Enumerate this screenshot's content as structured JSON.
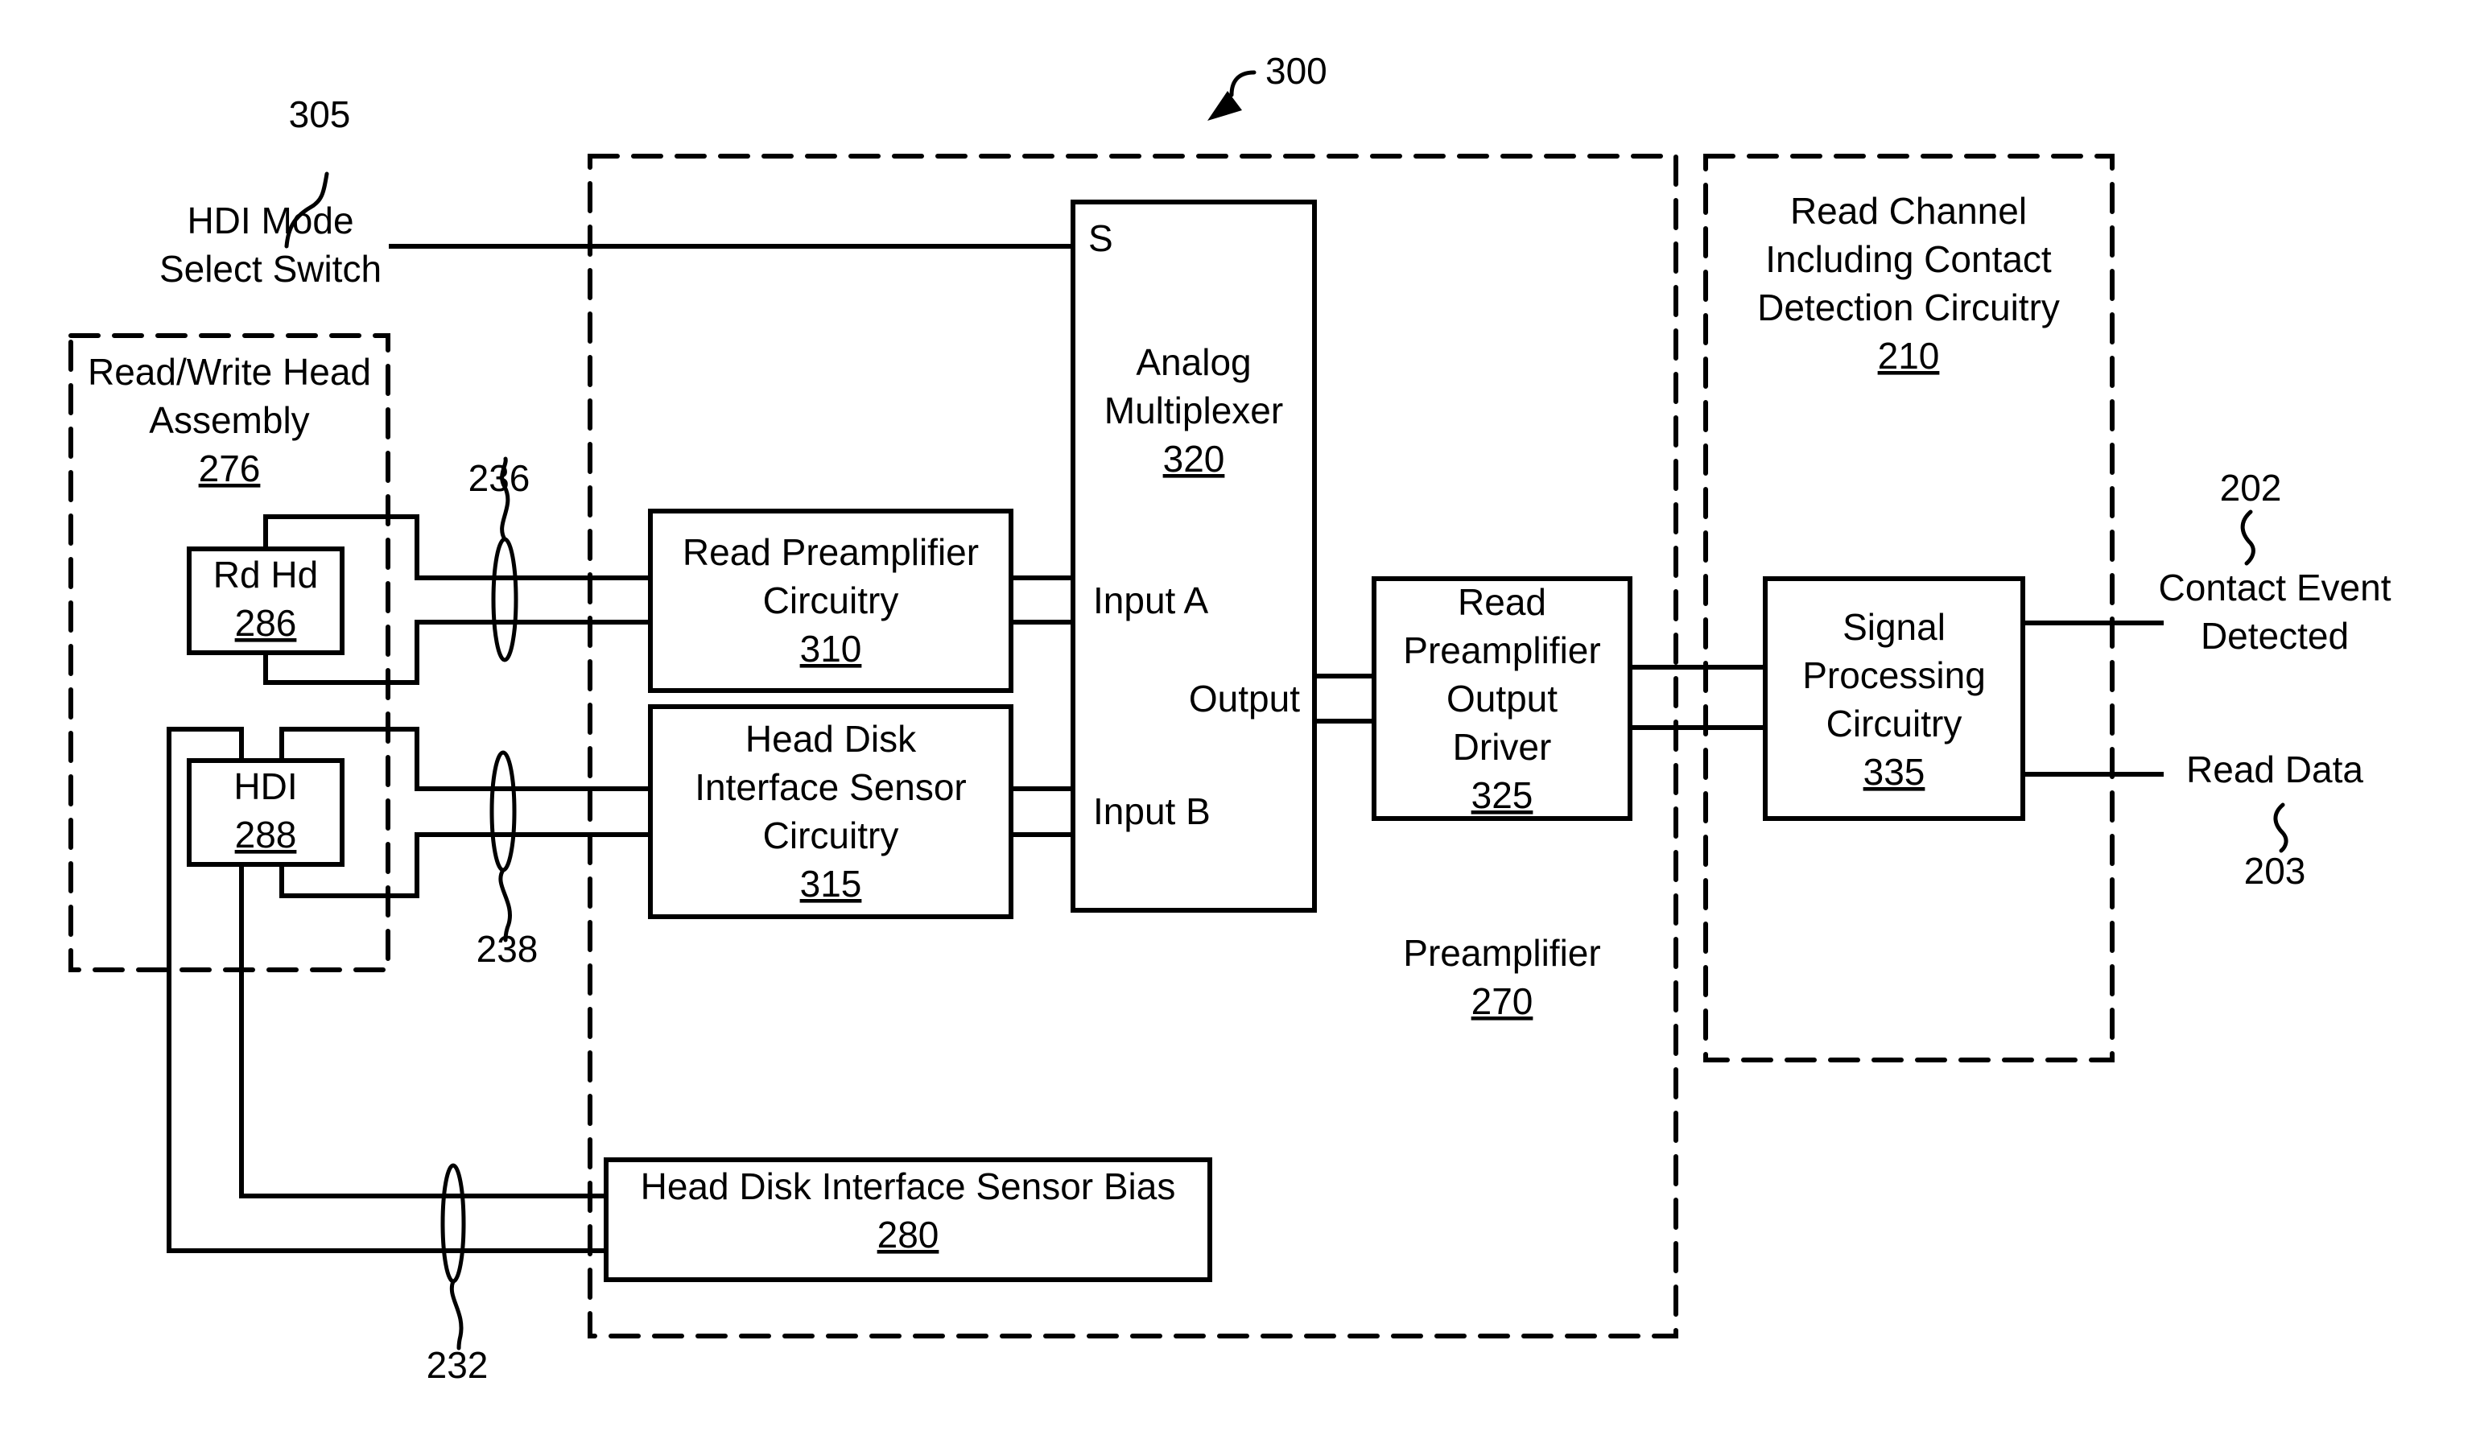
{
  "figure_ref": "300",
  "mode_switch": {
    "label_line1": "HDI Mode",
    "label_line2": "Select Switch",
    "ref": "305"
  },
  "rw_head_assembly": {
    "line1": "Read/Write Head",
    "line2": "Assembly",
    "ref": "276"
  },
  "rd_hd": {
    "label": "Rd Hd",
    "ref": "286"
  },
  "hdi": {
    "label": "HDI",
    "ref": "288"
  },
  "bus_refs": {
    "read_bus": "236",
    "hdi_bus": "238",
    "bias_bus": "232"
  },
  "read_preamp": {
    "line1": "Read Preamplifier",
    "line2": "Circuitry",
    "ref": "310"
  },
  "hdi_sensor": {
    "line1": "Head Disk",
    "line2": "Interface Sensor",
    "line3": "Circuitry",
    "ref": "315"
  },
  "mux": {
    "select": "S",
    "line1": "Analog",
    "line2": "Multiplexer",
    "ref": "320",
    "input_a": "Input A",
    "input_b": "Input B",
    "output": "Output"
  },
  "output_driver": {
    "line1": "Read",
    "line2": "Preamplifier",
    "line3": "Output",
    "line4": "Driver",
    "ref": "325"
  },
  "preamplifier": {
    "label": "Preamplifier",
    "ref": "270"
  },
  "bias": {
    "label": "Head Disk Interface Sensor Bias",
    "ref": "280"
  },
  "read_channel": {
    "line1": "Read Channel",
    "line2": "Including Contact",
    "line3": "Detection Circuitry",
    "ref": "210"
  },
  "signal_processing": {
    "line1": "Signal",
    "line2": "Processing",
    "line3": "Circuitry",
    "ref": "335"
  },
  "contact_event": {
    "line1": "Contact Event",
    "line2": "Detected",
    "ref": "202"
  },
  "read_data": {
    "label": "Read Data",
    "ref": "203"
  }
}
